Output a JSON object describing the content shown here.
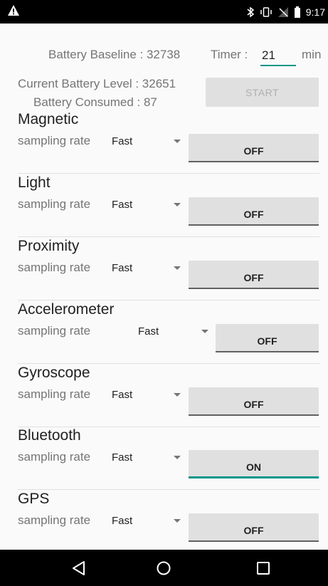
{
  "status_bar": {
    "time": "9:17",
    "icons": [
      "warning-icon",
      "bluetooth-icon",
      "vibrate-icon",
      "no-signal-icon",
      "battery-icon"
    ]
  },
  "battery": {
    "baseline_label": "Battery Baseline : 32738",
    "timer_label": "Timer :",
    "timer_value": "21",
    "timer_unit": "min",
    "current_level_label": "Current Battery Level : 32651",
    "consumed_label": "Battery Consumed : 87",
    "start_label": "START"
  },
  "sensors": [
    {
      "name": "Magnetic",
      "rate_label": "sampling rate",
      "rate_value": "Fast",
      "toggle": "OFF"
    },
    {
      "name": "Light",
      "rate_label": "sampling rate",
      "rate_value": "Fast",
      "toggle": "OFF"
    },
    {
      "name": "Proximity",
      "rate_label": "sampling rate",
      "rate_value": "Fast",
      "toggle": "OFF"
    },
    {
      "name": "Accelerometer",
      "rate_label": "sampling rate",
      "rate_value": "Fast",
      "toggle": "OFF"
    },
    {
      "name": "Gyroscope",
      "rate_label": "sampling rate",
      "rate_value": "Fast",
      "toggle": "OFF"
    },
    {
      "name": "Bluetooth",
      "rate_label": "sampling rate",
      "rate_value": "Fast",
      "toggle": "ON"
    },
    {
      "name": "GPS",
      "rate_label": "sampling rate",
      "rate_value": "Fast",
      "toggle": "OFF"
    }
  ],
  "colors": {
    "accent": "#009688",
    "toggle_bg": "#e0e0e0",
    "status_bar": "#000000"
  },
  "nav_bar": {
    "icons": [
      "back-icon",
      "home-icon",
      "recents-icon"
    ]
  }
}
